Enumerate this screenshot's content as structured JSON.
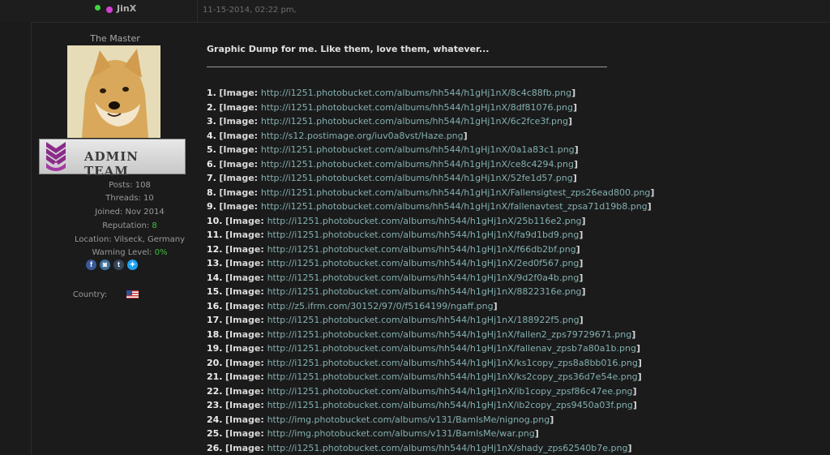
{
  "post_header": {
    "username": "JinX",
    "date": "11-15-2014, 02:22 pm,"
  },
  "user_panel": {
    "title": "The Master",
    "avatar_alt": "doge avatar",
    "rank_banner": "ADMIN TEAM",
    "posts_label": "Posts: ",
    "posts_value": "108",
    "threads_label": "Threads: ",
    "threads_value": "10",
    "joined_label": "Joined: ",
    "joined_value": "Nov 2014",
    "reputation_label": "Reputation: ",
    "reputation_value": "8",
    "location_label": "Location: ",
    "location_value": "Vilseck, Germany",
    "warning_label": "Warning Level: ",
    "warning_value": "0%",
    "social": [
      {
        "name": "facebook-icon",
        "glyph": "f",
        "color": "#3b5998"
      },
      {
        "name": "instagram-icon",
        "glyph": "◙",
        "color": "#3f729b"
      },
      {
        "name": "tumblr-icon",
        "glyph": "t",
        "color": "#35465c"
      },
      {
        "name": "twitter-icon",
        "glyph": "✦",
        "color": "#1da1f2"
      }
    ],
    "country_label": "Country:",
    "country_flag_icon": "us-flag-icon"
  },
  "post": {
    "heading": "Graphic Dump for me. Like them, love them, whatever...",
    "image_prefix": "[Image: ",
    "image_suffix": "]",
    "images": [
      {
        "num": "1.",
        "url": "http://i1251.photobucket.com/albums/hh544/h1gHj1nX/8c4c88fb.png"
      },
      {
        "num": "2.",
        "url": "http://i1251.photobucket.com/albums/hh544/h1gHj1nX/8df81076.png"
      },
      {
        "num": "3.",
        "url": "http://i1251.photobucket.com/albums/hh544/h1gHj1nX/6c2fce3f.png"
      },
      {
        "num": "4.",
        "url": "http://s12.postimage.org/iuv0a8vst/Haze.png"
      },
      {
        "num": "5.",
        "url": "http://i1251.photobucket.com/albums/hh544/h1gHj1nX/0a1a83c1.png"
      },
      {
        "num": "6.",
        "url": "http://i1251.photobucket.com/albums/hh544/h1gHj1nX/ce8c4294.png"
      },
      {
        "num": "7.",
        "url": "http://i1251.photobucket.com/albums/hh544/h1gHj1nX/52fe1d57.png"
      },
      {
        "num": "8.",
        "url": "http://i1251.photobucket.com/albums/hh544/h1gHj1nX/Fallensigtest_zps26ead800.png"
      },
      {
        "num": "9.",
        "url": "http://i1251.photobucket.com/albums/hh544/h1gHj1nX/fallenavtest_zpsa71d19b8.png"
      },
      {
        "num": "10.",
        "url": "http://i1251.photobucket.com/albums/hh544/h1gHj1nX/25b116e2.png"
      },
      {
        "num": "11.",
        "url": "http://i1251.photobucket.com/albums/hh544/h1gHj1nX/fa9d1bd9.png"
      },
      {
        "num": "12.",
        "url": "http://i1251.photobucket.com/albums/hh544/h1gHj1nX/f66db2bf.png"
      },
      {
        "num": "13.",
        "url": "http://i1251.photobucket.com/albums/hh544/h1gHj1nX/2ed0f567.png"
      },
      {
        "num": "14.",
        "url": "http://i1251.photobucket.com/albums/hh544/h1gHj1nX/9d2f0a4b.png"
      },
      {
        "num": "15.",
        "url": "http://i1251.photobucket.com/albums/hh544/h1gHj1nX/8822316e.png"
      },
      {
        "num": "16.",
        "url": "http://z5.ifrm.com/30152/97/0/f5164199/ngaff.png"
      },
      {
        "num": "17.",
        "url": "http://i1251.photobucket.com/albums/hh544/h1gHj1nX/188922f5.png"
      },
      {
        "num": "18.",
        "url": "http://i1251.photobucket.com/albums/hh544/h1gHj1nX/fallen2_zps79729671.png"
      },
      {
        "num": "19.",
        "url": "http://i1251.photobucket.com/albums/hh544/h1gHj1nX/fallenav_zpsb7a80a1b.png"
      },
      {
        "num": "20.",
        "url": "http://i1251.photobucket.com/albums/hh544/h1gHj1nX/ks1copy_zps8a8bb016.png"
      },
      {
        "num": "21.",
        "url": "http://i1251.photobucket.com/albums/hh544/h1gHj1nX/ks2copy_zps36d7e54e.png"
      },
      {
        "num": "22.",
        "url": "http://i1251.photobucket.com/albums/hh544/h1gHj1nX/ib1copy_zpsf86c47ee.png"
      },
      {
        "num": "23.",
        "url": "http://i1251.photobucket.com/albums/hh544/h1gHj1nX/ib2copy_zps9450a03f.png"
      },
      {
        "num": "24.",
        "url": "http://img.photobucket.com/albums/v131/BamIsMe/nignog.png"
      },
      {
        "num": "25.",
        "url": "http://img.photobucket.com/albums/v131/BamIsMe/war.png"
      },
      {
        "num": "26.",
        "url": "http://i1251.photobucket.com/albums/hh544/h1gHj1nX/shady_zps62540b7e.png"
      }
    ]
  }
}
